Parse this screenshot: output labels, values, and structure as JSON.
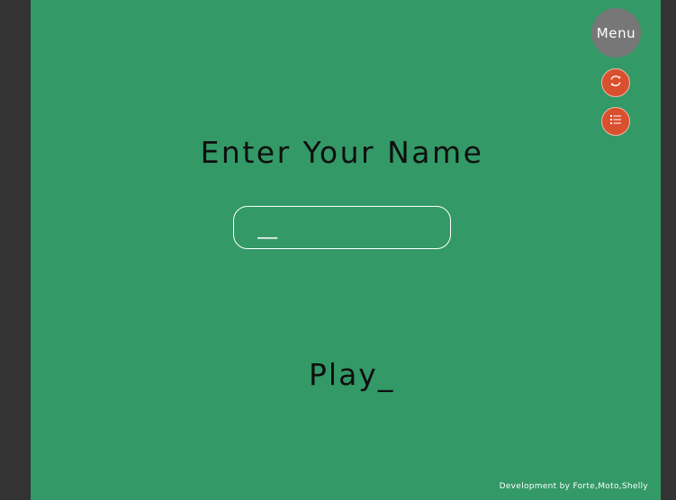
{
  "menu": {
    "label": "Menu"
  },
  "controls": {
    "restart_icon": "refresh-icon",
    "leaderboard_icon": "list-icon"
  },
  "heading": {
    "title": "Enter Your Name"
  },
  "name_input": {
    "value": "",
    "placeholder": "__"
  },
  "play": {
    "label": "Play_"
  },
  "footer": {
    "credits": "Development by Forte,Moto,Shelly"
  },
  "colors": {
    "background": "#333333",
    "stage": "#339966",
    "menu_button": "#777777",
    "circle_button": "#d9502f"
  }
}
